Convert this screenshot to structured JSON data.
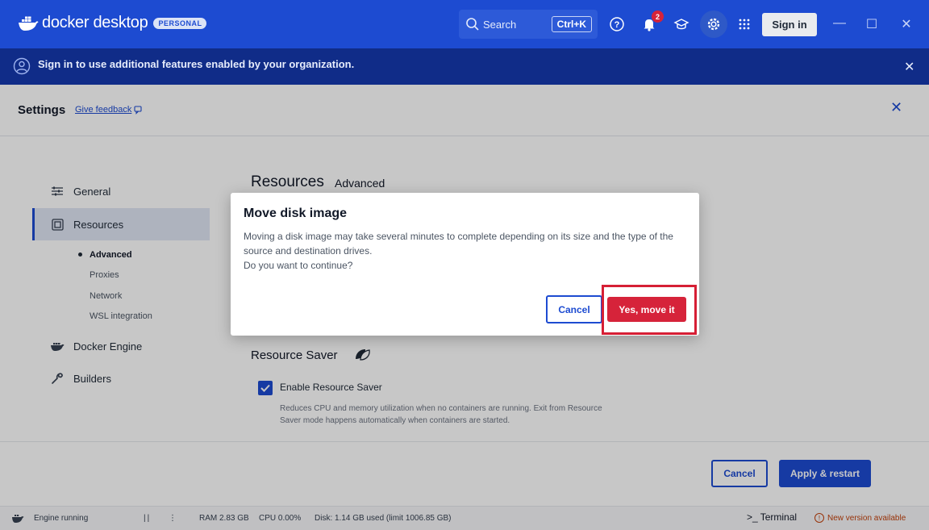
{
  "titlebar": {
    "app_name": "docker desktop",
    "plan_badge": "PERSONAL",
    "search_label": "Search",
    "search_shortcut": "Ctrl+K",
    "notification_count": "2",
    "signin_label": "Sign in",
    "colors": {
      "background": "#1d4bd1"
    }
  },
  "banner": {
    "message": "Sign in to use additional features enabled by your organization."
  },
  "settings": {
    "title": "Settings",
    "feedback_label": "Give feedback"
  },
  "sidebar": {
    "items": [
      {
        "label": "General",
        "icon": "sliders-icon"
      },
      {
        "label": "Resources",
        "icon": "resources-icon"
      },
      {
        "label": "Docker Engine",
        "icon": "engine-icon"
      },
      {
        "label": "Builders",
        "icon": "wrench-icon"
      }
    ],
    "resources_sub": [
      "Advanced",
      "Proxies",
      "Network",
      "WSL integration"
    ]
  },
  "main": {
    "section_title": "Resources",
    "active_tab": "Advanced",
    "saver": {
      "title": "Resource Saver",
      "checkbox_label": "Enable Resource Saver",
      "checked": true,
      "description": "Reduces CPU and memory utilization when no containers are running. Exit from Resource Saver mode happens automatically when containers are started."
    },
    "cancel_label": "Cancel",
    "apply_label": "Apply & restart"
  },
  "dialog": {
    "title": "Move disk image",
    "line1": "Moving a disk image may take several minutes to complete depending on its size and the type of the source and destination drives.",
    "line2": "Do you want to continue?",
    "cancel_label": "Cancel",
    "confirm_label": "Yes, move it",
    "colors": {
      "confirm": "#d6233a"
    }
  },
  "statusbar": {
    "engine": "Engine running",
    "ram": "RAM 2.83 GB",
    "cpu": "CPU 0.00%",
    "disk": "Disk: 1.14 GB used (limit 1006.85 GB)",
    "terminal": "Terminal",
    "update": "New version available"
  }
}
